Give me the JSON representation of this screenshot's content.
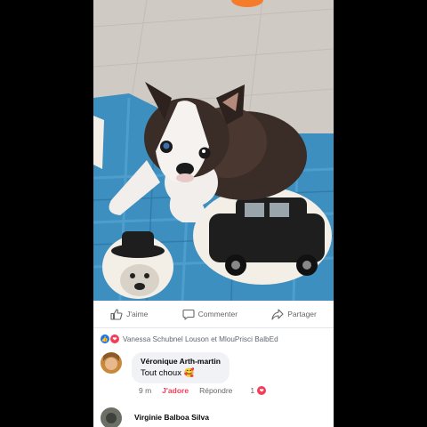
{
  "post": {
    "image": {
      "subject": "dog-photo"
    },
    "actions": [
      {
        "icon": "thumbs-up-icon",
        "label": "J'aime"
      },
      {
        "icon": "comment-bubble-icon",
        "label": "Commenter"
      },
      {
        "icon": "share-arrow-icon",
        "label": "Partager"
      }
    ],
    "reactions": {
      "icons": [
        "like-reaction-icon",
        "love-reaction-icon"
      ],
      "text": "Vanessa Schubnel Louson et MlouPrisci BalbEd"
    }
  },
  "comments": [
    {
      "author": "Véronique Arth-martin",
      "text": "Tout choux 🥰",
      "time": "9 m",
      "reaction_label": "J'adore",
      "reply_label": "Répondre",
      "reaction_count": "1"
    },
    {
      "author": "Virginie Balboa Silva"
    }
  ],
  "colors": {
    "accent_blue": "#1877f2",
    "love_red": "#f33e58",
    "meta_gray": "#65676b"
  }
}
